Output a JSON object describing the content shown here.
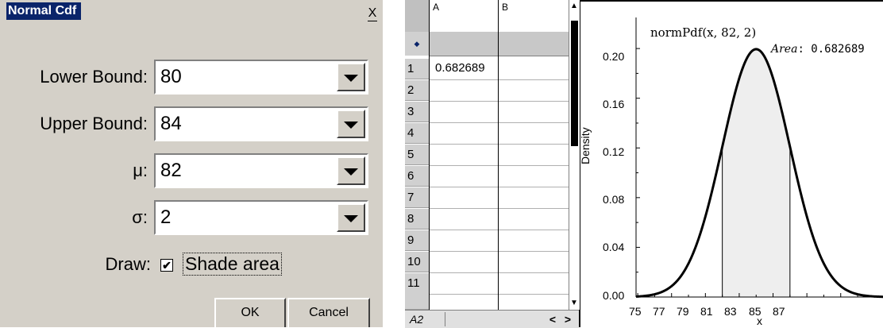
{
  "dialog": {
    "title": "Normal Cdf",
    "close_glyph": "X",
    "fields": {
      "lower": {
        "label": "Lower Bound:",
        "value": "80"
      },
      "upper": {
        "label": "Upper Bound:",
        "value": "84"
      },
      "mu": {
        "label": "μ:",
        "value": "82"
      },
      "sigma": {
        "label": "σ:",
        "value": "2"
      }
    },
    "draw_label": "Draw:",
    "shade_label": "Shade area",
    "shade_checked": true,
    "ok_label": "OK",
    "cancel_label": "Cancel"
  },
  "sheet": {
    "col_a": "A",
    "col_b": "B",
    "rows": [
      "1",
      "2",
      "3",
      "4",
      "5",
      "6",
      "7",
      "8",
      "9",
      "10",
      "11"
    ],
    "a1_value": "0.682689",
    "cell_ref": "A2"
  },
  "graph": {
    "function_label": "normPdf(x, 82, 2)",
    "area_label_key": "Area",
    "area_value": ": 0.682689",
    "ylabel": "Density",
    "xlabel": "x",
    "yticks": [
      "0.00",
      "0.04",
      "0.08",
      "0.12",
      "0.16",
      "0.20"
    ],
    "xticks": [
      "75",
      "77",
      "79",
      "81",
      "83",
      "85",
      "87"
    ]
  },
  "chart_data": {
    "type": "line",
    "function": "normPdf",
    "mu": 82,
    "sigma": 2,
    "shade_from": 80,
    "shade_to": 84,
    "area": 0.682689,
    "xlabel": "x",
    "ylabel": "Density",
    "xlim": [
      74.9,
      89.5
    ],
    "ylim": [
      0,
      0.225
    ],
    "colors": {
      "curve": "#000000",
      "shade": "#eeeeee"
    }
  }
}
